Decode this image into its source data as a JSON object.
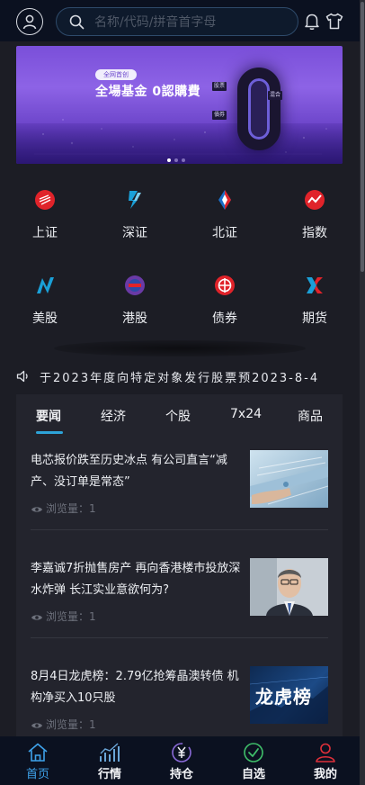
{
  "header": {
    "search_placeholder": "名称/代码/拼音首字母",
    "icons": [
      "user-icon",
      "search-icon",
      "bell-icon",
      "shirt-icon"
    ]
  },
  "banner": {
    "tag": "全网首创",
    "title": "全場基金 0認購費",
    "labels": [
      "股票",
      "混合",
      "債券"
    ],
    "dots": 3,
    "active_dot": 0
  },
  "markets": [
    {
      "label": "上证",
      "icon": "sse-icon",
      "color": "#e0232a"
    },
    {
      "label": "深证",
      "icon": "szse-icon",
      "color": "#1aa0d8"
    },
    {
      "label": "北证",
      "icon": "bse-icon",
      "color": "#e0232a"
    },
    {
      "label": "指数",
      "icon": "index-icon",
      "color": "#e0232a"
    },
    {
      "label": "美股",
      "icon": "us-stock-icon",
      "color": "#1aa0d8"
    },
    {
      "label": "港股",
      "icon": "hk-stock-icon",
      "color": "#6a3aa6"
    },
    {
      "label": "债券",
      "icon": "bond-icon",
      "color": "#e0232a"
    },
    {
      "label": "期货",
      "icon": "futures-icon",
      "color": "#1aa0d8"
    }
  ],
  "notice": {
    "icon": "speaker-icon",
    "text": "于2023年度向特定对象发行股票预2023-8-4"
  },
  "news": {
    "tabs": [
      "要闻",
      "经济",
      "个股",
      "7x24",
      "商品"
    ],
    "active_tab": 0,
    "views_label": "浏览量：",
    "items": [
      {
        "title": "电芯报价跌至历史冰点 有公司直言“减产、没订单是常态”",
        "views": "1",
        "thumb": "battery-photo"
      },
      {
        "title": "李嘉诚7折抛售房产 再向香港楼市投放深水炸弹 长江实业意欲何为?",
        "views": "1",
        "thumb": "portrait-photo"
      },
      {
        "title": "8月4日龙虎榜：2.79亿抢筹晶澳转债 机构净买入10只股",
        "views": "1",
        "thumb": "longhubang-photo",
        "thumb_text": "龙虎榜"
      }
    ]
  },
  "bottom_nav": {
    "items": [
      {
        "label": "首页",
        "icon": "home-icon"
      },
      {
        "label": "行情",
        "icon": "chart-icon"
      },
      {
        "label": "持仓",
        "icon": "yen-icon"
      },
      {
        "label": "自选",
        "icon": "check-icon"
      },
      {
        "label": "我的",
        "icon": "user-icon"
      }
    ],
    "active": 0
  },
  "colors": {
    "accent": "#3ea2ea",
    "header_bg": "#0b1120",
    "panel_bg": "#1c1d25",
    "card_bg": "#23242d"
  }
}
